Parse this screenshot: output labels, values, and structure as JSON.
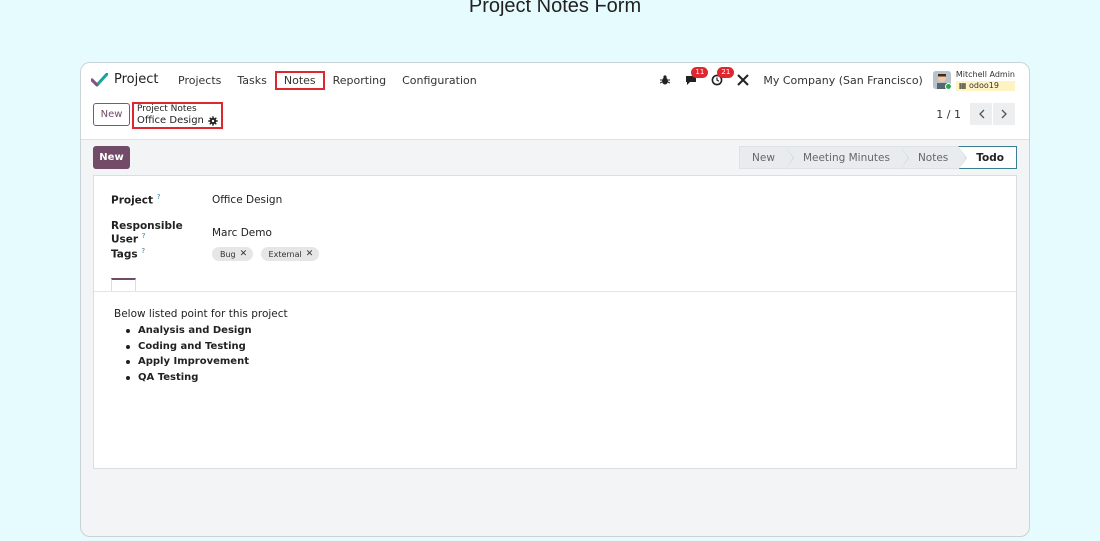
{
  "heading": "Project Notes Form",
  "navbar": {
    "app_name": "Project",
    "menu": [
      "Projects",
      "Tasks",
      "Notes",
      "Reporting",
      "Configuration"
    ],
    "active_menu": "Notes",
    "chat_badge": "11",
    "activity_badge": "21",
    "company": "My Company (San Francisco)",
    "user_name": "Mitchell Admin",
    "database": "odoo19"
  },
  "control": {
    "new_label": "New",
    "breadcrumb_parent": "Project Notes",
    "breadcrumb_current": "Office Design",
    "pager": "1 / 1"
  },
  "actions": {
    "new_label": "New"
  },
  "statusbar": {
    "stages": [
      "New",
      "Meeting Minutes",
      "Notes",
      "Todo"
    ],
    "active": "Todo"
  },
  "form": {
    "project_label": "Project",
    "project_value": "Office Design",
    "user_label": "Responsible User",
    "user_value": "Marc Demo",
    "tags_label": "Tags",
    "tags": [
      "Bug",
      "External"
    ],
    "help_mark": "?"
  },
  "notes": {
    "intro": "Below listed point for this project",
    "points": [
      "Analysis and Design",
      "Coding and Testing",
      "Apply Improvement",
      "QA Testing"
    ]
  },
  "colors": {
    "brand": "#714B67",
    "highlight": "#e0272f",
    "background": "#e6fbfd"
  }
}
